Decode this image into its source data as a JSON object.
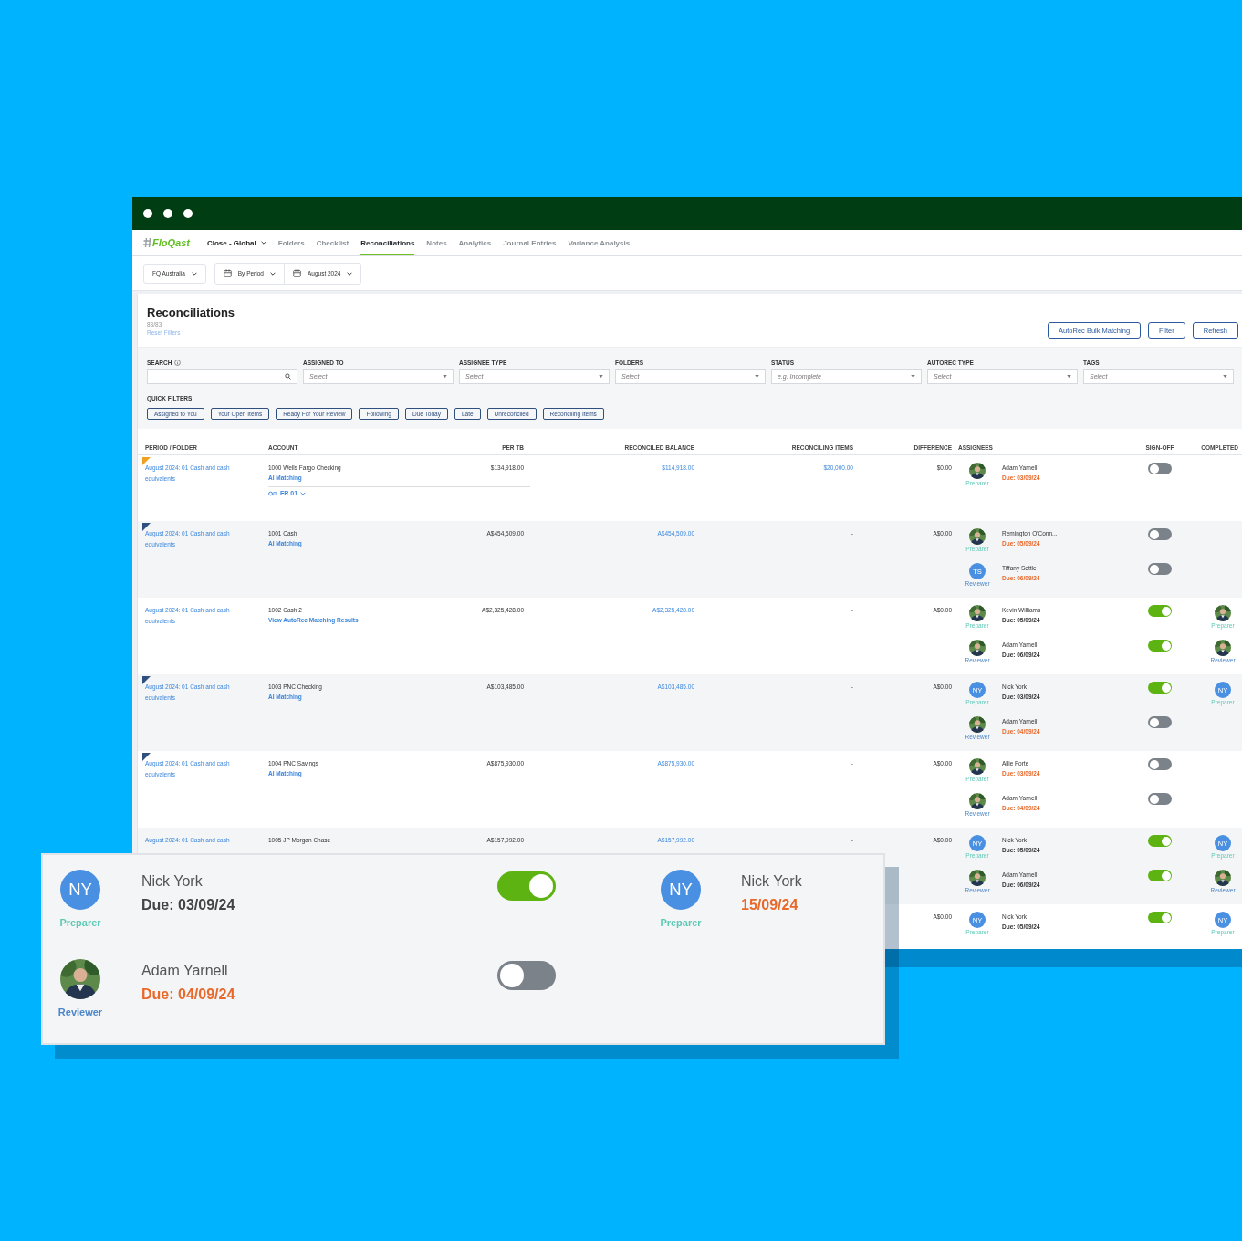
{
  "nav": {
    "logo": "FloQast",
    "workspace": "Close - Global",
    "tabs": [
      {
        "label": "Folders",
        "selected": false
      },
      {
        "label": "Checklist",
        "selected": false
      },
      {
        "label": "Reconciliations",
        "selected": true
      },
      {
        "label": "Notes",
        "selected": false
      },
      {
        "label": "Analytics",
        "selected": false
      },
      {
        "label": "Journal Entries",
        "selected": false
      },
      {
        "label": "Variance Analysis",
        "selected": false
      }
    ]
  },
  "toolbar": {
    "entity": "FQ Australia",
    "period_mode": "By Period",
    "period": "August 2024"
  },
  "page": {
    "title": "Reconciliations",
    "count": "83/83",
    "reset": "Reset Filters",
    "actions": [
      "AutoRec Bulk Matching",
      "Filter",
      "Refresh"
    ]
  },
  "filters": [
    {
      "label": "SEARCH",
      "kind": "search"
    },
    {
      "label": "ASSIGNED TO",
      "kind": "select",
      "placeholder": "Select"
    },
    {
      "label": "ASSIGNEE TYPE",
      "kind": "select",
      "placeholder": "Select"
    },
    {
      "label": "FOLDERS",
      "kind": "select",
      "placeholder": "Select"
    },
    {
      "label": "STATUS",
      "kind": "select",
      "placeholder": "e.g. Incomplete"
    },
    {
      "label": "AUTOREC TYPE",
      "kind": "select",
      "placeholder": "Select"
    },
    {
      "label": "TAGS",
      "kind": "select",
      "placeholder": "Select"
    }
  ],
  "quick_filters": {
    "label": "QUICK FILTERS",
    "items": [
      "Assigned to You",
      "Your Open Items",
      "Ready For Your Review",
      "Following",
      "Due Today",
      "Late",
      "Unreconciled",
      "Reconciling Items"
    ]
  },
  "table": {
    "columns": [
      "PERIOD / FOLDER",
      "ACCOUNT",
      "PER TB",
      "RECONCILED BALANCE",
      "RECONCILING ITEMS",
      "DIFFERENCE",
      "ASSIGNEES",
      "SIGN-OFF",
      "COMPLETED"
    ],
    "rows": [
      {
        "flag": {
          "color": "#f0a020"
        },
        "period": "August 2024: 01 Cash and cash equivalents",
        "account": "1000 Wells Fargo Checking",
        "account_link": "AI Matching",
        "tag": "FR.01",
        "per_tb": "$134,918.00",
        "reconciled_balance": "$114,918.00",
        "reconciling_items": {
          "text": "$20,000.00",
          "link": true
        },
        "difference": "$0.00",
        "assignees": [
          {
            "role": "Preparer",
            "kind": "preparer",
            "name": "Adam Yarnell",
            "due": "Due: 03/09/24",
            "late": true,
            "signed_off": false
          }
        ]
      },
      {
        "flag": {
          "color": "#2f4f7f"
        },
        "period": "August 2024: 01 Cash and cash equivalents",
        "account": "1001 Cash",
        "account_link": "AI Matching",
        "per_tb": "A$454,509.00",
        "reconciled_balance": "A$454,509.00",
        "reconciling_items": {
          "text": "-"
        },
        "difference": "A$0.00",
        "assignees": [
          {
            "role": "Preparer",
            "kind": "preparer",
            "name": "Remington O'Conn...",
            "due": "Due: 05/09/24",
            "late": true,
            "signed_off": false
          },
          {
            "avatar": {
              "kind": "initials",
              "initials": "TS"
            },
            "role": "Reviewer",
            "kind": "reviewer",
            "name": "Tiffany Settle",
            "due": "Due: 06/09/24",
            "late": true,
            "signed_off": false
          }
        ]
      },
      {
        "period": "August 2024: 01 Cash and cash equivalents",
        "account": "1002 Cash 2",
        "account_link": "View AutoRec Matching Results",
        "per_tb": "A$2,325,428.00",
        "reconciled_balance": "A$2,325,428.00",
        "reconciling_items": {
          "text": "-"
        },
        "difference": "A$0.00",
        "assignees": [
          {
            "role": "Preparer",
            "kind": "preparer",
            "name": "Kevin Williams",
            "due": "Due: 05/09/24",
            "late": false,
            "signed_off": true,
            "completed": {
              "role": "Preparer",
              "kind": "preparer"
            }
          },
          {
            "role": "Reviewer",
            "kind": "reviewer",
            "name": "Adam Yarnell",
            "due": "Due: 06/09/24",
            "late": false,
            "signed_off": true,
            "completed": {
              "role": "Reviewer",
              "kind": "reviewer"
            }
          }
        ]
      },
      {
        "flag": {
          "color": "#2f4f7f"
        },
        "period": "August 2024: 01 Cash and cash equivalents",
        "account": "1003 PNC Checking",
        "account_link": "AI Matching",
        "per_tb": "A$103,485.00",
        "reconciled_balance": "A$103,485.00",
        "reconciling_items": {
          "text": "-"
        },
        "difference": "A$0.00",
        "assignees": [
          {
            "avatar": {
              "kind": "initials",
              "initials": "NY"
            },
            "role": "Preparer",
            "kind": "preparer",
            "name": "Nick York",
            "due": "Due: 03/09/24",
            "late": false,
            "signed_off": true,
            "completed": {
              "avatar": {
                "kind": "initials",
                "initials": "NY"
              },
              "role": "Preparer",
              "kind": "preparer"
            }
          },
          {
            "role": "Reviewer",
            "kind": "reviewer",
            "name": "Adam Yarnell",
            "due": "Due: 04/09/24",
            "late": true,
            "signed_off": false
          }
        ]
      },
      {
        "flag": {
          "color": "#2f4f7f"
        },
        "period": "August 2024: 01 Cash and cash equivalents",
        "account": "1004 PNC Savings",
        "account_link": "AI Matching",
        "per_tb": "A$875,930.00",
        "reconciled_balance": "A$875,930.00",
        "reconciling_items": {
          "text": "-"
        },
        "difference": "A$0.00",
        "assignees": [
          {
            "role": "Preparer",
            "kind": "preparer",
            "name": "Allie Forte",
            "due": "Due: 03/09/24",
            "late": true,
            "signed_off": false
          },
          {
            "role": "Reviewer",
            "kind": "reviewer",
            "name": "Adam Yarnell",
            "due": "Due: 04/09/24",
            "late": true,
            "signed_off": false
          }
        ]
      },
      {
        "period": "August 2024: 01 Cash and cash",
        "account": "1005 JP Morgan Chase",
        "per_tb": "A$157,992.00",
        "reconciled_balance": "A$157,992.00",
        "reconciling_items": {
          "text": "-"
        },
        "difference": "A$0.00",
        "assignees": [
          {
            "avatar": {
              "kind": "initials",
              "initials": "NY"
            },
            "role": "Preparer",
            "kind": "preparer",
            "name": "Nick York",
            "due": "Due: 05/09/24",
            "late": false,
            "signed_off": true,
            "completed": {
              "avatar": {
                "kind": "initials",
                "initials": "NY"
              },
              "role": "Preparer",
              "kind": "preparer"
            }
          },
          {
            "role": "Reviewer",
            "kind": "reviewer",
            "name": "Adam Yarnell",
            "due": "Due: 06/09/24",
            "late": false,
            "signed_off": true,
            "completed": {
              "role": "Reviewer",
              "kind": "reviewer"
            }
          }
        ]
      },
      {
        "difference": "A$0.00",
        "assignees": [
          {
            "avatar": {
              "kind": "initials",
              "initials": "NY"
            },
            "role": "Preparer",
            "kind": "preparer",
            "name": "Nick York",
            "due": "Due: 05/09/24",
            "late": false,
            "signed_off": true,
            "completed": {
              "avatar": {
                "kind": "initials",
                "initials": "NY"
              },
              "role": "Preparer",
              "kind": "preparer"
            }
          }
        ]
      }
    ]
  },
  "zoom_card": {
    "entries": [
      {
        "avatar": {
          "kind": "initials",
          "initials": "NY"
        },
        "role": "Preparer",
        "kind": "preparer",
        "name": "Nick York",
        "due": "Due: 03/09/24",
        "late": false,
        "signed_off": true,
        "completed": {
          "avatar": {
            "kind": "initials",
            "initials": "NY"
          },
          "role": "Preparer",
          "kind": "preparer",
          "name": "Nick York",
          "date": "15/09/24",
          "late": true
        }
      },
      {
        "role": "Reviewer",
        "kind": "reviewer",
        "name": "Adam Yarnell",
        "due": "Due: 04/09/24",
        "late": true,
        "signed_off": false
      }
    ]
  }
}
